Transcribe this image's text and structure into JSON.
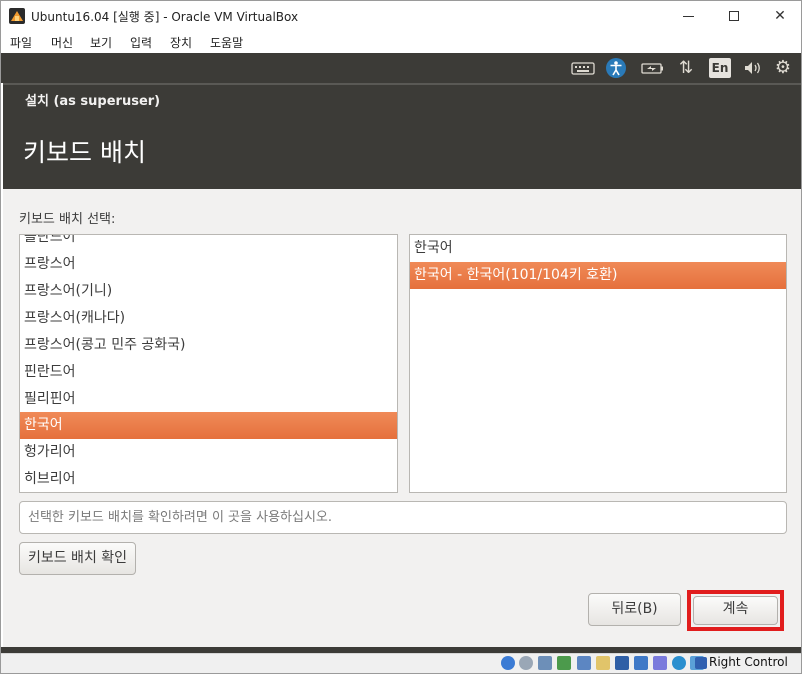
{
  "window": {
    "title": "Ubuntu16.04 [실행 중] - Oracle VM VirtualBox",
    "minimize_glyph": "—",
    "close_glyph": "✕"
  },
  "menubar": {
    "items": [
      "파일",
      "머신",
      "보기",
      "입력",
      "장치",
      "도움말"
    ]
  },
  "panel": {
    "keyboard_icon": "keyboard-icon",
    "accessibility_icon": "accessibility-icon",
    "battery_icon": "battery-icon",
    "network_icon": "network-arrows-icon",
    "network_glyph": "⇅",
    "input_method": "En",
    "volume_icon": "volume-icon",
    "volume_glyph": "🔊",
    "settings_icon": "gear-icon",
    "settings_glyph": "⚙"
  },
  "installer": {
    "superuser_title": "설치 (as superuser)",
    "page_title": "키보드 배치",
    "select_label": "키보드 배치 선택:",
    "layouts": [
      "폴란드어",
      "프랑스어",
      "프랑스어(기니)",
      "프랑스어(캐나다)",
      "프랑스어(콩고 민주 공화국)",
      "핀란드어",
      "필리핀어",
      "한국어",
      "헝가리어",
      "히브리어"
    ],
    "selected_layout": "한국어",
    "variants": [
      "한국어",
      "한국어 - 한국어(101/104키 호환)"
    ],
    "selected_variant": "한국어 - 한국어(101/104키 호환)",
    "test_placeholder": "선택한 키보드 배치를 확인하려면 이 곳을 사용하십시오.",
    "detect_button": "키보드 배치 확인",
    "back_button": "뒤로(B)",
    "continue_button": "계속"
  },
  "statusbar": {
    "host_key": "Right Control",
    "icons": [
      "hard-disk-icon",
      "optical-drive-icon",
      "audio-icon",
      "network-icon",
      "usb-icon",
      "shared-folders-icon",
      "display-icon",
      "video-capture-icon",
      "recording-icon",
      "virtualization-icon",
      "mouse-integration-icon",
      "host-key-icon"
    ]
  },
  "colors": {
    "selection": "#e9773f",
    "panel": "#3c3b37",
    "highlight_box": "#e11d1d",
    "accessibility_blue": "#2a7ab8"
  }
}
